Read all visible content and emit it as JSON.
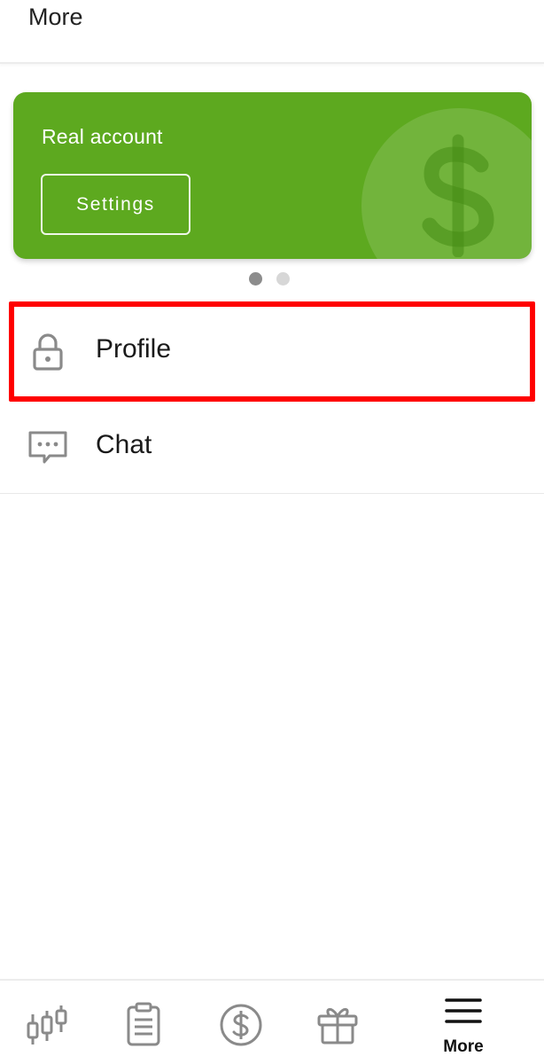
{
  "header": {
    "title": "More"
  },
  "account_card": {
    "title": "Real account",
    "settings_label": "Settings",
    "background_color": "#5da91f",
    "decor_icon": "dollar-sign-icon"
  },
  "carousel": {
    "page_count": 2,
    "active_index": 0
  },
  "menu": {
    "items": [
      {
        "label": "Profile",
        "icon": "lock-icon",
        "highlighted": true
      },
      {
        "label": "Chat",
        "icon": "chat-bubble-icon",
        "highlighted": false
      }
    ]
  },
  "bottom_nav": {
    "items": [
      {
        "icon": "candlestick-chart-icon",
        "label": ""
      },
      {
        "icon": "clipboard-list-icon",
        "label": ""
      },
      {
        "icon": "dollar-circle-icon",
        "label": ""
      },
      {
        "icon": "gift-icon",
        "label": ""
      },
      {
        "icon": "hamburger-menu-icon",
        "label": "More",
        "active": true
      }
    ]
  },
  "colors": {
    "highlight": "#ff0000",
    "icon_gray": "#8a8a8a",
    "text": "#1a1a1a"
  }
}
